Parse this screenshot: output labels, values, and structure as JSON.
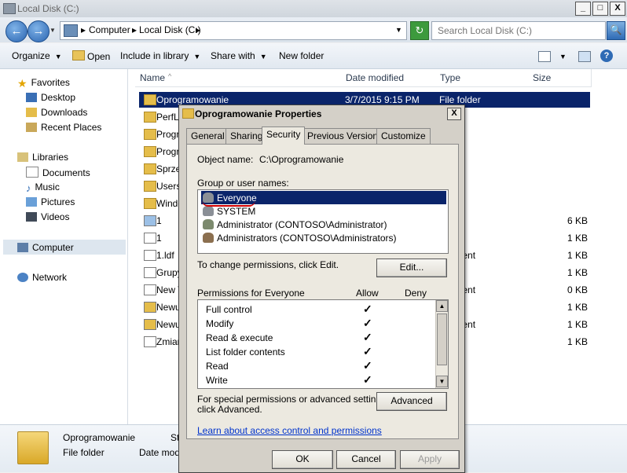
{
  "window": {
    "title": "Local Disk (C:)",
    "min_label": "_",
    "max_label": "□",
    "close_label": "X"
  },
  "address": {
    "crumbs": [
      "Computer",
      "Local Disk (C:)"
    ],
    "separator": "▸",
    "back_label": "←",
    "forward_label": "→",
    "search_placeholder": "Search Local Disk (C:)",
    "refresh_label": "↻",
    "search_btn_label": "🔍"
  },
  "toolbar": {
    "organize": "Organize",
    "open": "Open",
    "include": "Include in library",
    "share": "Share with",
    "newfolder": "New folder",
    "help_label": "?"
  },
  "nav": {
    "favorites": "Favorites",
    "desktop": "Desktop",
    "downloads": "Downloads",
    "recent": "Recent Places",
    "libraries": "Libraries",
    "documents": "Documents",
    "music": "Music",
    "pictures": "Pictures",
    "videos": "Videos",
    "computer": "Computer",
    "network": "Network"
  },
  "columns": {
    "name": "Name",
    "sort_arrow": "^",
    "date": "Date modified",
    "type": "Type",
    "size": "Size"
  },
  "files": [
    {
      "name": "Oprogramowanie",
      "date": "3/7/2015 9:15 PM",
      "type": "File folder",
      "size": ""
    },
    {
      "name": "PerfL",
      "date": "",
      "type": "older",
      "size": ""
    },
    {
      "name": "Progr",
      "date": "",
      "type": "older",
      "size": ""
    },
    {
      "name": "Progr",
      "date": "",
      "type": "older",
      "size": ""
    },
    {
      "name": "Sprze",
      "date": "",
      "type": "older",
      "size": ""
    },
    {
      "name": "Users",
      "date": "",
      "type": "older",
      "size": ""
    },
    {
      "name": "Windo",
      "date": "",
      "type": "older",
      "size": ""
    },
    {
      "name": "1",
      "date": "",
      "type": "mage",
      "size": "6 KB"
    },
    {
      "name": "1",
      "date": "",
      "type": "e",
      "size": "1 KB"
    },
    {
      "name": "1.ldf",
      "date": "",
      "type": "ocument",
      "size": "1 KB"
    },
    {
      "name": "Grupy",
      "date": "",
      "type": "e",
      "size": "1 KB"
    },
    {
      "name": "New T",
      "date": "",
      "type": "ocument",
      "size": "0 KB"
    },
    {
      "name": "Newu",
      "date": "",
      "type": "e",
      "size": "1 KB"
    },
    {
      "name": "Newu",
      "date": "",
      "type": "ocument",
      "size": "1 KB"
    },
    {
      "name": "Zmian",
      "date": "",
      "type": "e",
      "size": "1 KB"
    }
  ],
  "details": {
    "name": "Oprogramowanie",
    "type": "File folder",
    "state_label": "St",
    "date_label": "Date modi"
  },
  "dialog": {
    "title": "Oprogramowanie Properties",
    "close_label": "X",
    "tabs": [
      "General",
      "Sharing",
      "Security",
      "Previous Versions",
      "Customize"
    ],
    "active_tab": "Security",
    "object_label": "Object name:",
    "object_value": "C:\\Oprogramowanie",
    "group_label": "Group or user names:",
    "users": [
      "Everyone",
      "SYSTEM",
      "Administrator (CONTOSO\\Administrator)",
      "Administrators (CONTOSO\\Administrators)"
    ],
    "change_text": "To change permissions, click Edit.",
    "edit_btn": "Edit...",
    "perm_for": "Permissions for Everyone",
    "allow": "Allow",
    "deny": "Deny",
    "permissions": [
      {
        "name": "Full control",
        "allow": "✓"
      },
      {
        "name": "Modify",
        "allow": "✓"
      },
      {
        "name": "Read & execute",
        "allow": "✓"
      },
      {
        "name": "List folder contents",
        "allow": "✓"
      },
      {
        "name": "Read",
        "allow": "✓"
      },
      {
        "name": "Write",
        "allow": "✓"
      }
    ],
    "special_text_1": "For special permissions or advanced settings,",
    "special_text_2": "click Advanced.",
    "advanced_btn": "Advanced",
    "learn_link": "Learn about access control and permissions",
    "ok": "OK",
    "cancel": "Cancel",
    "apply": "Apply",
    "scroll_up": "▲",
    "scroll_down": "▼"
  }
}
